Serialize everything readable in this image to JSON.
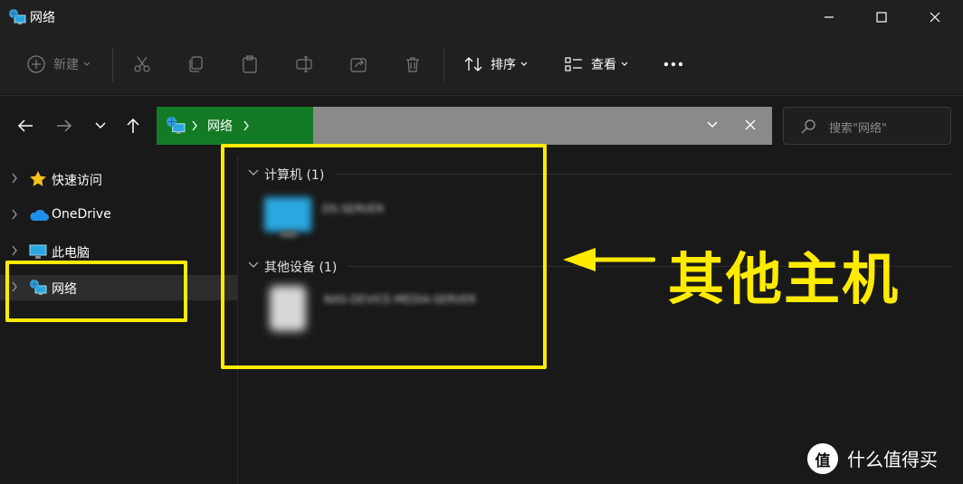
{
  "window": {
    "title": "网络"
  },
  "toolbar": {
    "new_label": "新建",
    "sort_label": "排序",
    "view_label": "查看"
  },
  "address": {
    "location": "网络",
    "search_placeholder": "搜索\"网络\""
  },
  "sidebar": {
    "items": [
      {
        "label": "快速访问",
        "icon": "star-icon"
      },
      {
        "label": "OneDrive",
        "icon": "cloud-icon"
      },
      {
        "label": "此电脑",
        "icon": "monitor-icon"
      },
      {
        "label": "网络",
        "icon": "network-icon",
        "selected": true
      }
    ]
  },
  "content": {
    "groups": [
      {
        "header": "计算机 (1)",
        "item_name": "DS-SERVER"
      },
      {
        "header": "其他设备 (1)",
        "item_name": "NAS-DEVICE-MEDIA-SERVER"
      }
    ]
  },
  "annotation": {
    "label": "其他主机",
    "color": "#ffeb00"
  },
  "watermark": {
    "text": "什么值得买",
    "badge": "值"
  },
  "colors": {
    "address_highlight": "#137b26",
    "address_bar": "#8a8a8a",
    "background": "#191919"
  }
}
